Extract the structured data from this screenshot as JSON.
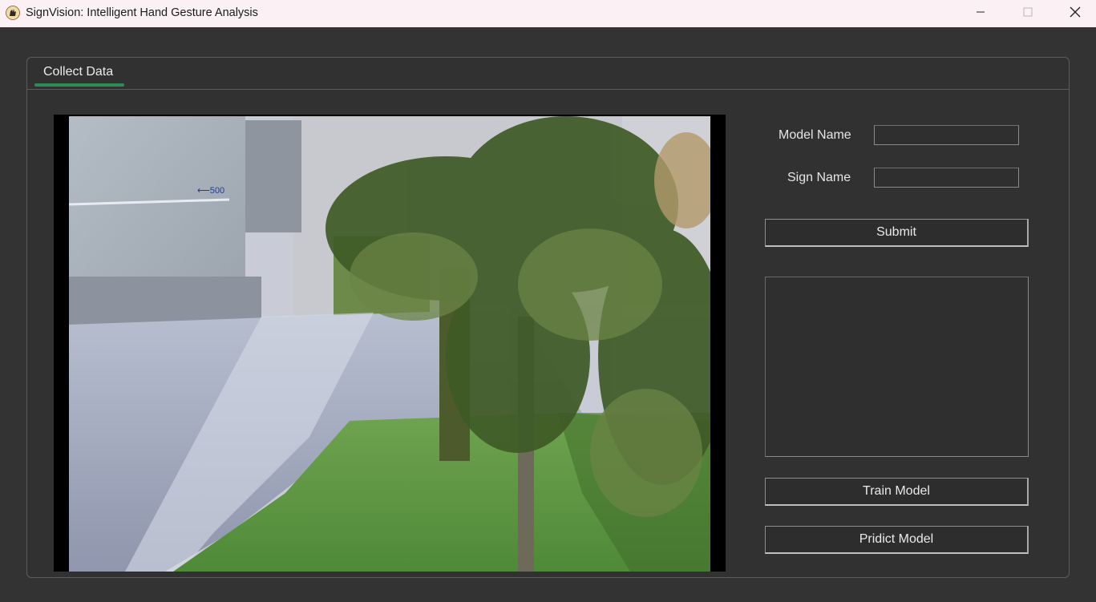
{
  "window": {
    "title": "SignVision: Intelligent Hand Gesture Analysis",
    "icon": "app-logo-icon",
    "controls": [
      "minimize-icon",
      "maximize-icon",
      "close-icon"
    ]
  },
  "tabs": [
    {
      "label": "Collect Data",
      "active": true
    }
  ],
  "accent_color": "#2e8b57",
  "camera": {
    "description_icon": "camera-feed"
  },
  "form": {
    "model_name_label": "Model Name",
    "model_name_value": "",
    "sign_name_label": "Sign Name",
    "sign_name_value": "",
    "submit_label": "Submit"
  },
  "output": {
    "text": ""
  },
  "actions": {
    "train_label": "Train Model",
    "predict_label": "Pridict Model"
  }
}
